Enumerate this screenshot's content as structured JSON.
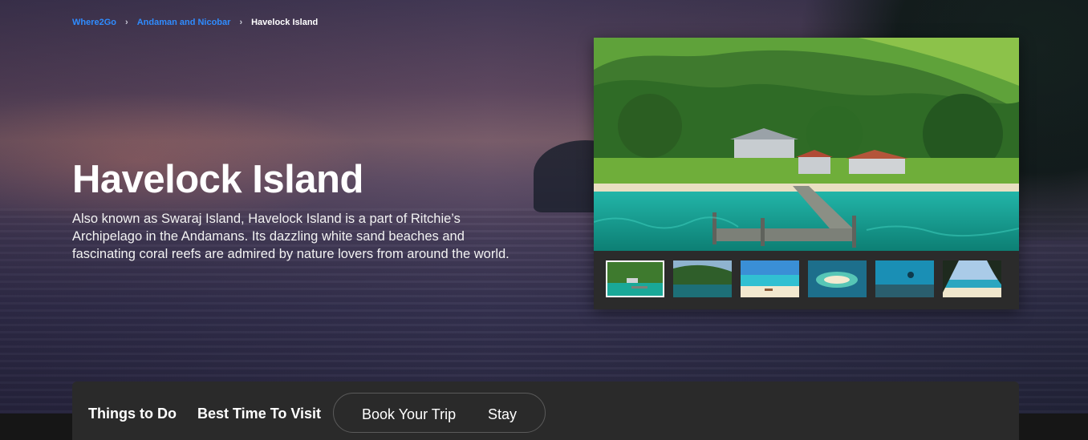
{
  "breadcrumb": {
    "items": [
      "Where2Go",
      "Andaman and Nicobar"
    ],
    "current": "Havelock Island",
    "separator": "›"
  },
  "hero": {
    "title": "Havelock Island",
    "description": "Also known as Swaraj Island, Havelock Island is a part of Ritchie’s Archipelago in the Andamans. Its dazzling white sand beaches and fascinating coral reefs are admired by nature lovers from around the world."
  },
  "gallery": {
    "active_index": 0,
    "thumbnails": [
      "pier-hills",
      "forest-bay",
      "turquoise-beach",
      "sandbar-aerial",
      "coral-reef-diver",
      "beach-through-trees"
    ]
  },
  "tabs": {
    "things_to_do": "Things to Do",
    "best_time": "Best Time To Visit",
    "book_trip": "Book Your Trip",
    "stay": "Stay"
  },
  "colors": {
    "link": "#2f8cff",
    "tabbar_bg": "#2a2a2a",
    "gallery_bg": "#2b2b2b"
  }
}
